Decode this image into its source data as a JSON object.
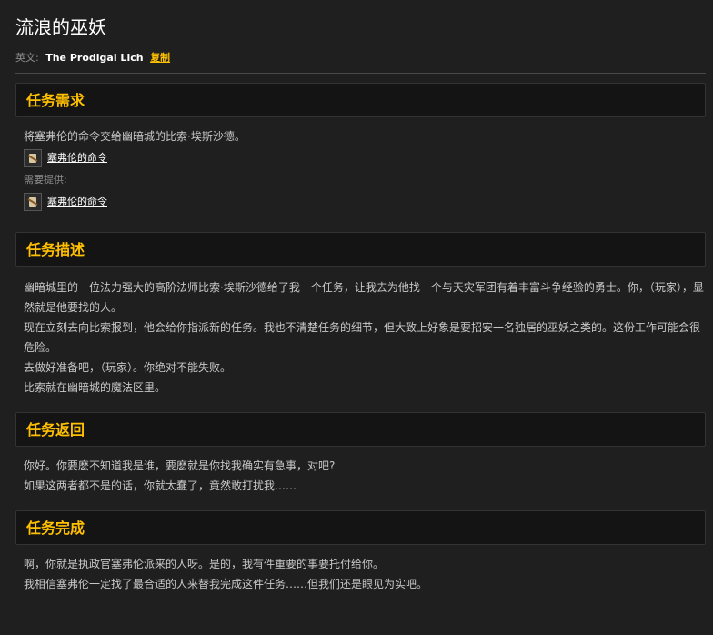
{
  "page_title": "流浪的巫妖",
  "english": {
    "label": "英文:",
    "name": "The Prodigal Lich",
    "copy": "复制"
  },
  "sections": {
    "requirements": {
      "heading": "任务需求",
      "text": "将塞弗伦的命令交给幽暗城的比索·埃斯沙德。",
      "item": "塞弗伦的命令",
      "provided_label": "需要提供:",
      "provided_item": "塞弗伦的命令"
    },
    "description": {
      "heading": "任务描述",
      "lines": [
        "幽暗城里的一位法力强大的高阶法师比索·埃斯沙德给了我一个任务，让我去为他找一个与天灾军团有着丰富斗争经验的勇士。你，（玩家），显然就是他要找的人。",
        "现在立刻去向比索报到，他会给你指派新的任务。我也不清楚任务的细节，但大致上好象是要招安一名独居的巫妖之类的。这份工作可能会很危险。",
        "去做好准备吧，（玩家）。你绝对不能失败。",
        "比索就在幽暗城的魔法区里。"
      ]
    },
    "return": {
      "heading": "任务返回",
      "lines": [
        "你好。你要麽不知道我是谁，要麽就是你找我确实有急事，对吧?",
        "如果这两者都不是的话，你就太蠢了，竟然敢打扰我……"
      ]
    },
    "complete": {
      "heading": "任务完成",
      "lines": [
        "啊，你就是执政官塞弗伦派来的人呀。是的，我有件重要的事要托付给你。",
        "我相信塞弗伦一定找了最合适的人来替我完成这件任务……但我们还是眼见为实吧。"
      ]
    }
  },
  "icons": {
    "item": "scroll-icon"
  },
  "colors": {
    "accent": "#ffc000",
    "background": "#1f1f1f",
    "header_bg": "#141414"
  }
}
